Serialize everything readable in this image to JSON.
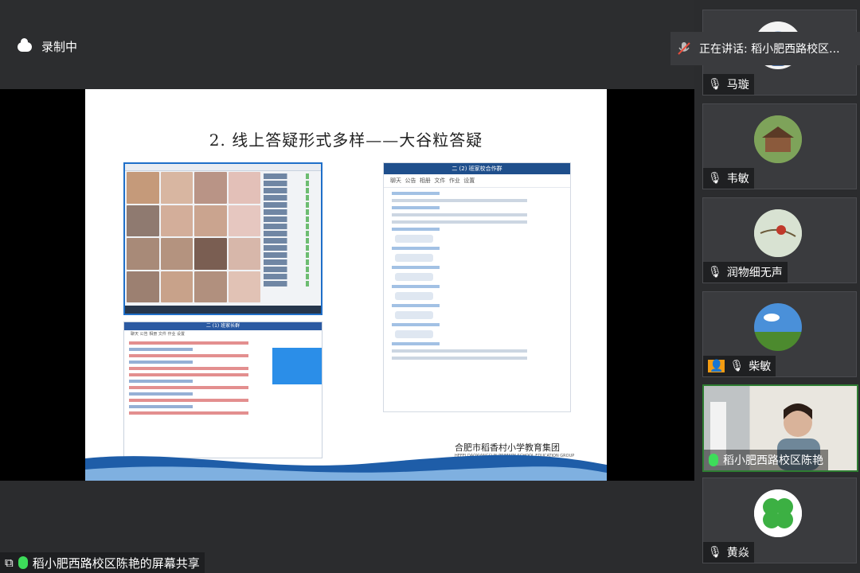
{
  "recording": {
    "label": "录制中"
  },
  "speaking": {
    "label": "正在讲话: 稻小肥西路校区..."
  },
  "slide": {
    "title": "2. 线上答疑形式多样——大谷粒答疑",
    "right_chat_header": "二 (2) 班家校合作群",
    "left_chat_header": "二 (1) 班家长群",
    "right_tabs": [
      "聊天",
      "公告",
      "相册",
      "文件",
      "作业",
      "设置"
    ],
    "left_tabs": [
      "聊天",
      "公告",
      "相册",
      "文件",
      "作业",
      "设置"
    ],
    "school_logo": "合肥市稻香村小学教育集团",
    "school_logo_en": "HEFEI DAOXIANGCUN PRIMARY SCHOOL EDUCATION GROUP"
  },
  "share": {
    "label": "稻小肥西路校区陈艳的屏幕共享"
  },
  "participants": [
    {
      "name": "马璇",
      "mic": "muted",
      "avatar": "blue-figure"
    },
    {
      "name": "韦敏",
      "mic": "muted",
      "avatar": "cabin"
    },
    {
      "name": "润物细无声",
      "mic": "muted",
      "avatar": "bird"
    },
    {
      "name": "柴敏",
      "mic": "muted",
      "avatar": "sky-field"
    },
    {
      "name": "稻小肥西路校区陈艳",
      "mic": "active",
      "avatar": "video"
    },
    {
      "name": "黄焱",
      "mic": "muted",
      "avatar": "clover"
    }
  ],
  "colors": {
    "bg": "#2b2c2e",
    "active_border": "#2e7d32",
    "mic_active": "#3ddc5a",
    "slide_blue": "#1f4f8c"
  }
}
